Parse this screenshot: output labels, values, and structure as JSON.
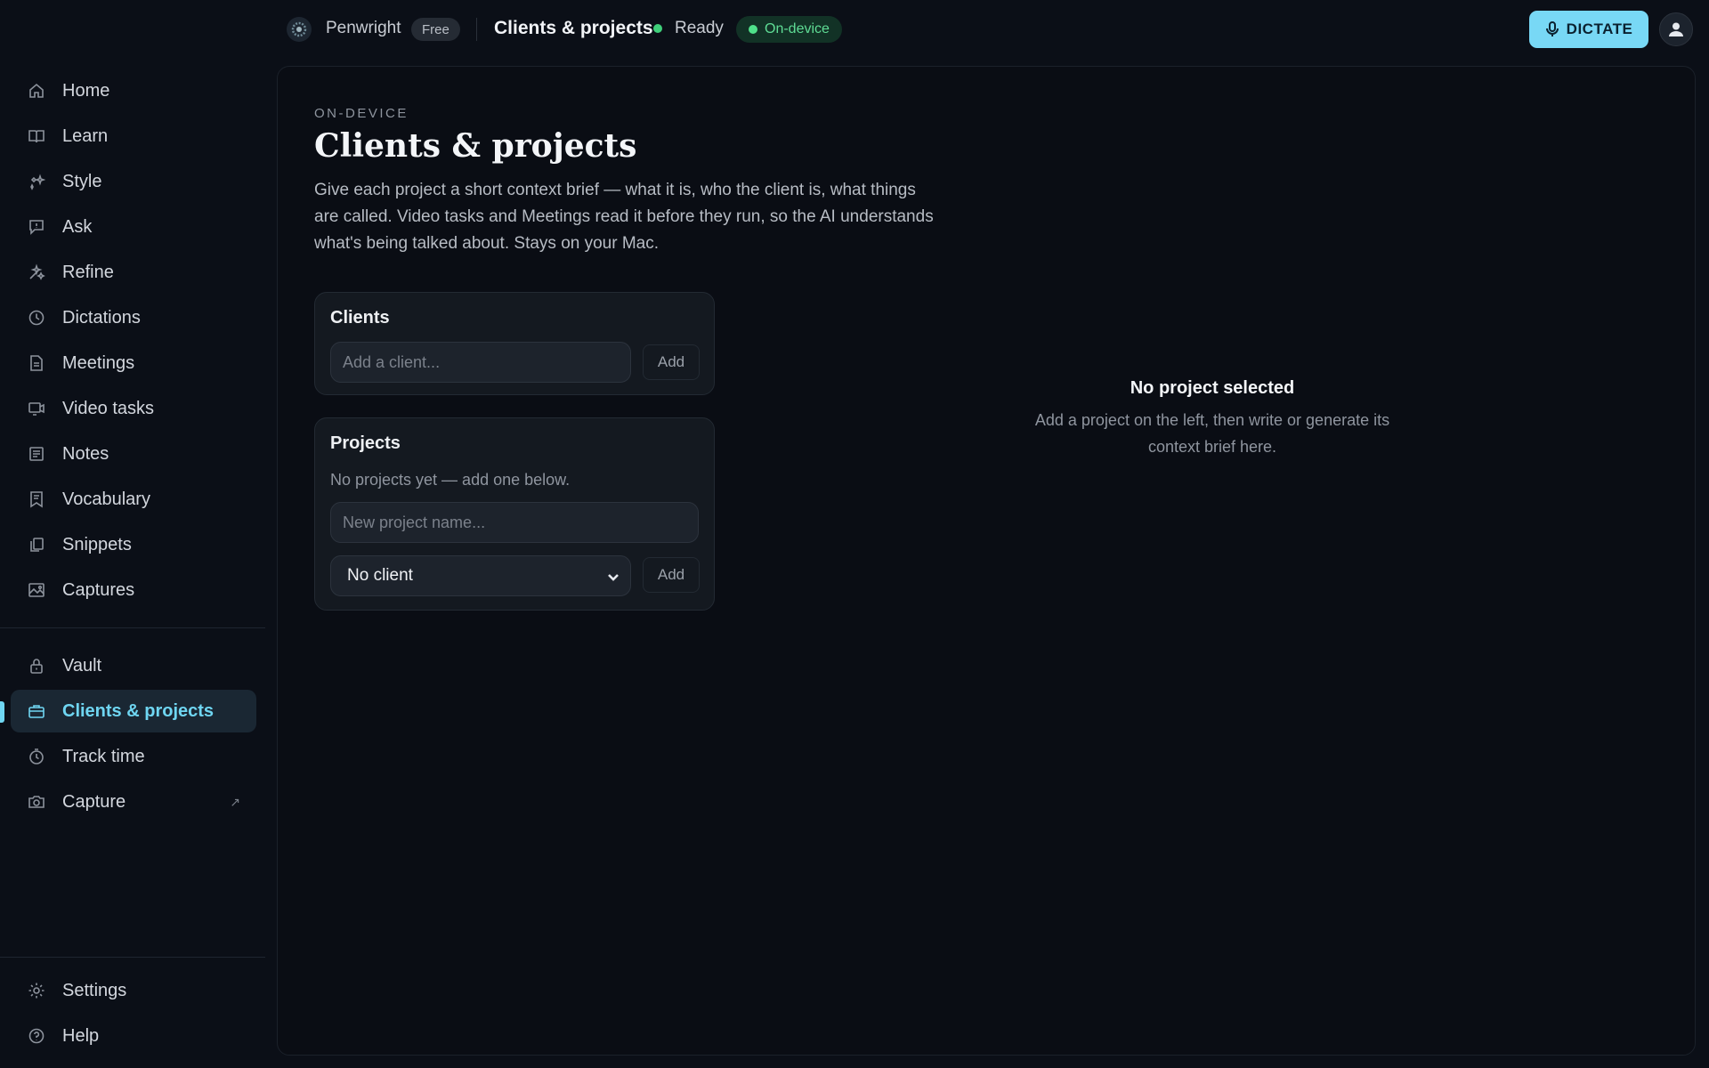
{
  "header": {
    "brand": "Penwright",
    "plan_badge": "Free",
    "title": "Clients & projects",
    "status": "Ready",
    "mode_badge": "On-device",
    "dictate_label": "DICTATE"
  },
  "sidebar": {
    "items": [
      {
        "label": "Home",
        "icon": "home-icon"
      },
      {
        "label": "Learn",
        "icon": "book-icon"
      },
      {
        "label": "Style",
        "icon": "sparkle-icon"
      },
      {
        "label": "Ask",
        "icon": "chat-icon"
      },
      {
        "label": "Refine",
        "icon": "magic-icon"
      },
      {
        "label": "Dictations",
        "icon": "clock-icon"
      },
      {
        "label": "Meetings",
        "icon": "document-icon"
      },
      {
        "label": "Video tasks",
        "icon": "video-icon"
      },
      {
        "label": "Notes",
        "icon": "notes-icon"
      },
      {
        "label": "Vocabulary",
        "icon": "bookmark-icon"
      },
      {
        "label": "Snippets",
        "icon": "copy-icon"
      },
      {
        "label": "Captures",
        "icon": "image-icon"
      }
    ],
    "secondary": [
      {
        "label": "Vault",
        "icon": "lock-icon"
      },
      {
        "label": "Clients & projects",
        "icon": "briefcase-icon",
        "active": true
      },
      {
        "label": "Track time",
        "icon": "timer-icon"
      },
      {
        "label": "Capture",
        "icon": "camera-icon",
        "external": "↗"
      }
    ],
    "footer": [
      {
        "label": "Settings",
        "icon": "gear-icon"
      },
      {
        "label": "Help",
        "icon": "help-icon"
      }
    ]
  },
  "main": {
    "eyebrow": "ON-DEVICE",
    "title": "Clients & projects",
    "description": "Give each project a short context brief — what it is, who the client is, what things are called. Video tasks and Meetings read it before they run, so the AI understands what's being talked about. Stays on your Mac.",
    "clients_card": {
      "title": "Clients",
      "input_placeholder": "Add a client...",
      "add_label": "Add"
    },
    "projects_card": {
      "title": "Projects",
      "empty_text": "No projects yet — add one below.",
      "input_placeholder": "New project name...",
      "client_select_value": "No client",
      "add_label": "Add"
    },
    "empty_state": {
      "title": "No project selected",
      "description": "Add a project on the left, then write or generate its context brief here."
    }
  },
  "colors": {
    "accent": "#6fd6f2",
    "status_green": "#3fcf7a",
    "background": "#0b0f17"
  }
}
